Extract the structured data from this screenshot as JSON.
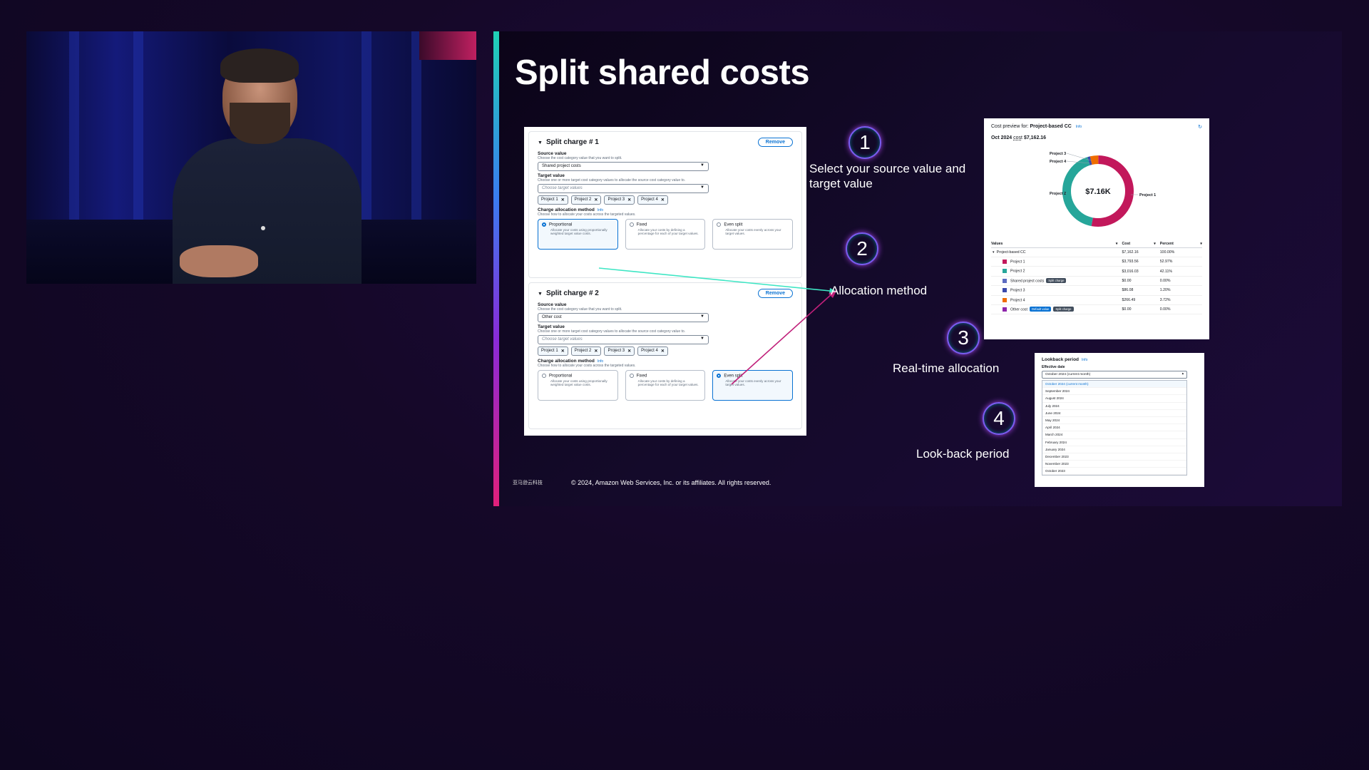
{
  "slide": {
    "title": "Split shared costs",
    "footer": "© 2024, Amazon Web Services, Inc. or its affiliates. All rights reserved.",
    "logo_text": "亚马逊云科技"
  },
  "steps": [
    {
      "number": "1",
      "text": "Select your source value and target value"
    },
    {
      "number": "2",
      "text": "Allocation method"
    },
    {
      "number": "3",
      "text": "Real-time allocation"
    },
    {
      "number": "4",
      "text": "Look-back period"
    }
  ],
  "charges": [
    {
      "title": "Split charge # 1",
      "remove": "Remove",
      "source_label": "Source value",
      "source_desc": "Choose the cost category value that you want to split.",
      "source_value": "Shared project costs",
      "target_label": "Target value",
      "target_desc": "Choose one or more target cost category values to allocate the source cost category value to.",
      "target_placeholder": "Choose target values",
      "tokens": [
        "Project 1",
        "Project 2",
        "Project 3",
        "Project 4"
      ],
      "method_label": "Charge allocation method",
      "method_info": "Info",
      "method_desc": "Choose how to allocate your costs across the targeted values.",
      "methods": [
        {
          "name": "Proportional",
          "desc": "Allocate your costs using proportionally weighted target value costs.",
          "selected": true
        },
        {
          "name": "Fixed",
          "desc": "Allocate your costs by defining a percentage for each of your target values.",
          "selected": false
        },
        {
          "name": "Even split",
          "desc": "Allocate your costs evenly across your target values.",
          "selected": false
        }
      ]
    },
    {
      "title": "Split charge # 2",
      "remove": "Remove",
      "source_label": "Source value",
      "source_desc": "Choose the cost category value that you want to split.",
      "source_value": "Other cost",
      "target_label": "Target value",
      "target_desc": "Choose one or more target cost category values to allocate the source cost category value to.",
      "target_placeholder": "Choose target values",
      "tokens": [
        "Project 1",
        "Project 2",
        "Project 3",
        "Project 4"
      ],
      "method_label": "Charge allocation method",
      "method_info": "Info",
      "method_desc": "Choose how to allocate your costs across the targeted values.",
      "methods": [
        {
          "name": "Proportional",
          "desc": "Allocate your costs using proportionally weighted target value costs.",
          "selected": false
        },
        {
          "name": "Fixed",
          "desc": "Allocate your costs by defining a percentage for each of your target values.",
          "selected": false
        },
        {
          "name": "Even split",
          "desc": "Allocate your costs evenly across your target values.",
          "selected": true
        }
      ]
    }
  ],
  "preview": {
    "label": "Cost preview for:",
    "name": "Project-based CC",
    "info": "Info",
    "period": "Oct 2024",
    "cost_word": "cost",
    "total": "$7,162.16",
    "donut_center": "$7.16K",
    "donut_labels": [
      "Project 3",
      "Project 4",
      "Project 2",
      "Project 1"
    ],
    "columns": [
      "Values",
      "Cost",
      "Percent"
    ],
    "rows": [
      {
        "name": "Project-based CC",
        "cost": "$7,162.16",
        "percent": "100.00%",
        "color": "",
        "badges": []
      },
      {
        "name": "Project 1",
        "cost": "$3,793.56",
        "percent": "52.97%",
        "color": "#c2185b",
        "badges": []
      },
      {
        "name": "Project 2",
        "cost": "$3,016.03",
        "percent": "42.11%",
        "color": "#26a69a",
        "badges": []
      },
      {
        "name": "Shared project costs",
        "cost": "$0.00",
        "percent": "0.00%",
        "color": "#5c6bc0",
        "badges": [
          "Split charge"
        ]
      },
      {
        "name": "Project 3",
        "cost": "$86.08",
        "percent": "1.20%",
        "color": "#3949ab",
        "badges": []
      },
      {
        "name": "Project 4",
        "cost": "$266.49",
        "percent": "3.72%",
        "color": "#ef6c00",
        "badges": []
      },
      {
        "name": "Other cost",
        "cost": "$0.00",
        "percent": "0.00%",
        "color": "#8e24aa",
        "badges": [
          "Default value",
          "Split charge"
        ]
      }
    ]
  },
  "lookback": {
    "title": "Lookback period",
    "info": "Info",
    "label": "Effective date",
    "selected": "October 2024 (current month)",
    "options": [
      "October 2024 (current month)",
      "September 2024",
      "August 2024",
      "July 2024",
      "June 2024",
      "May 2024",
      "April 2024",
      "March 2024",
      "February 2024",
      "January 2024",
      "December 2023",
      "November 2023",
      "October 2023"
    ]
  },
  "colors": {
    "slide_accent_top": "#1fd1b5",
    "slide_accent_bottom": "#e0207a",
    "connector_teal": "#3ee6c4",
    "connector_magenta": "#c0207a",
    "link_blue": "#0972d3"
  }
}
